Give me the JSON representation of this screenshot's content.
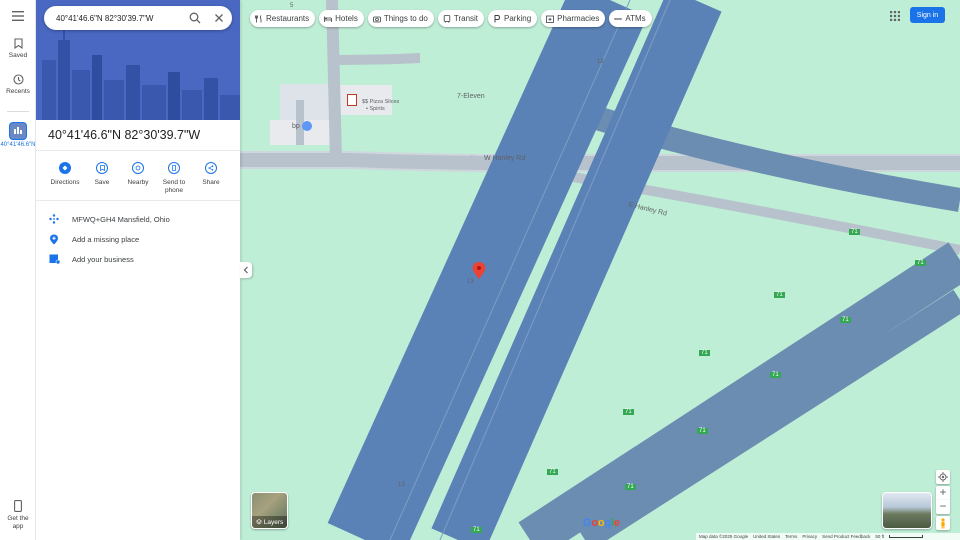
{
  "rail": {
    "saved_label": "Saved",
    "recents_label": "Recents",
    "recent_place_label": "40°41'46.6\"N",
    "get_app_label": "Get the app"
  },
  "search": {
    "value": "40°41'46.6\"N 82°30'39.7\"W"
  },
  "chips": [
    {
      "label": "Restaurants",
      "icon": "fork-knife-icon"
    },
    {
      "label": "Hotels",
      "icon": "bed-icon"
    },
    {
      "label": "Things to do",
      "icon": "camera-icon"
    },
    {
      "label": "Transit",
      "icon": "train-icon"
    },
    {
      "label": "Parking",
      "icon": "parking-icon"
    },
    {
      "label": "Pharmacies",
      "icon": "pharmacy-icon"
    },
    {
      "label": "ATMs",
      "icon": "atm-icon"
    }
  ],
  "signin_label": "Sign in",
  "place": {
    "title": "40°41'46.6\"N 82°30'39.7\"W",
    "actions": [
      {
        "label": "Directions",
        "icon": "directions-icon"
      },
      {
        "label": "Save",
        "icon": "bookmark-icon"
      },
      {
        "label": "Nearby",
        "icon": "nearby-icon"
      },
      {
        "label": "Send to phone",
        "icon": "phone-icon"
      },
      {
        "label": "Share",
        "icon": "share-icon"
      }
    ],
    "plus_code": "MFWQ+GH4 Mansfield, Ohio",
    "add_missing_place": "Add a missing place",
    "add_business": "Add your business"
  },
  "map": {
    "road_w_hanley": "W Hanley Rd",
    "road_e_hanley": "E Hanley Rd",
    "poi_711": "7-Eleven",
    "poi_pizza": "$$ Pizza Slices",
    "poi_spirits": "• Spirits",
    "poi_bp": "bp",
    "route_13": "13",
    "route_71": "71",
    "route_5": "5",
    "layers_label": "Layers",
    "logo": "Google"
  },
  "footer": {
    "map_data": "Map data ©2025 Google",
    "country": "United States",
    "terms": "Terms",
    "privacy": "Privacy",
    "feedback": "Send Product Feedback",
    "scale": "50 ft"
  },
  "colors": {
    "map_bg": "#bfeed6",
    "road": "#6b8db1",
    "highway": "#4f7ab3",
    "accent": "#1a73e8",
    "pin": "#ea4335"
  }
}
